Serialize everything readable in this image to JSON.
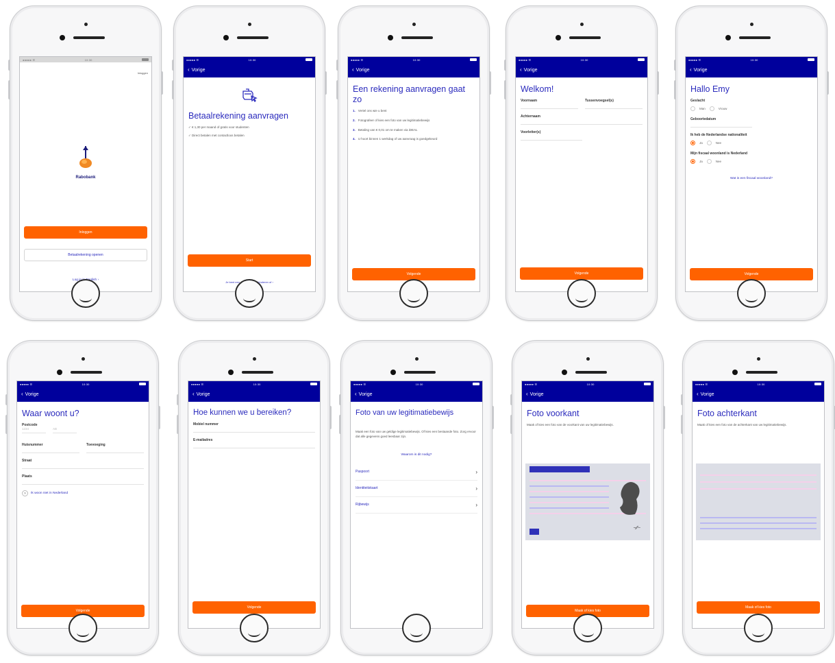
{
  "screens": {
    "s1": {
      "back_label": "",
      "top_right": "Inloggen",
      "logo_text": "Rabobank",
      "primary": "Inloggen",
      "secondary": "Betaalrekening openen",
      "link": "Log in in English  ›"
    },
    "s2": {
      "back_label": "Vorige",
      "title": "Betaalrekening aanvragen",
      "bullets": [
        "€ 1,30 per maand of gratis voor studenten",
        "Direct betalen met contactloos betalen"
      ],
      "primary": "Start",
      "link": "Je bent een rekening voor kinderen of  ›"
    },
    "s3": {
      "back_label": "Vorige",
      "title": "Een rekening aanvragen gaat zo",
      "steps": [
        "Vertel ons wie u bent",
        "Fotografeer of kies een foto van uw legitimatiebewijs",
        "Betaling van € 0,01 om te maken via iDEAL",
        "U hoort binnen 1 werkdag of uw aanvraag is goedgekeurd"
      ],
      "primary": "Volgende"
    },
    "s4": {
      "back_label": "Vorige",
      "title": "Welkom!",
      "first_name": "Voornaam",
      "infix": "Tussenvoegsel(s)",
      "last_name": "Achternaam",
      "initials": "Voorletter(s)",
      "primary": "Volgende"
    },
    "s5": {
      "back_label": "Vorige",
      "title": "Hallo Emy",
      "gender_label": "Geslacht",
      "gender_opts": [
        "Man",
        "Vrouw"
      ],
      "dob_label": "Geboortedatum",
      "nationality_label": "Ik heb de Nederlandse nationaliteit",
      "nat_opts": [
        "Ja",
        "Nee"
      ],
      "residence_label": "Mijn fiscaal woonland is Nederland",
      "res_opts": [
        "Ja",
        "Nee"
      ],
      "link": "Wat is een fiscaal woonland?",
      "primary": "Volgende"
    },
    "s6": {
      "back_label": "Vorige",
      "title": "Waar woont u?",
      "postcode_label": "Postcode",
      "postcode_ph": "1234",
      "postcode_ph2": "AB",
      "house_label": "Huisnummer",
      "addition_label": "Toevoeging",
      "street_label": "Straat",
      "city_label": "Plaats",
      "abroad": "Ik woon niet in Nederland",
      "primary": "Volgende"
    },
    "s7": {
      "back_label": "Vorige",
      "title": "Hoe kunnen we u bereiken?",
      "mobile_label": "Mobiel nummer",
      "email_label": "E-mailadres",
      "primary": "Volgende"
    },
    "s8": {
      "back_label": "Vorige",
      "title": "Foto van uw legitimatiebewijs",
      "text": "Maak een foto van uw geldige legitimatiebewijs. Of kies een bestaande foto. Zorg ervoor dat alle gegevens goed leesbaar zijn.",
      "why_link": "Waarom is dit nodig?",
      "docs": [
        "Paspoort",
        "Identiteitskaart",
        "Rijbewijs"
      ]
    },
    "s9": {
      "back_label": "Vorige",
      "title": "Foto voorkant",
      "text": "Maak of kies een foto van de voorkant van uw legitimatiebewijs.",
      "primary": "Maak of kies foto"
    },
    "s10": {
      "back_label": "Vorige",
      "title": "Foto achterkant",
      "text": "Maak of kies een foto van de achterkant van uw legitimatiebewijs.",
      "primary": "Maak of kies foto"
    }
  },
  "status": {
    "carrier": "●●●●● ☰",
    "time": "10:30",
    "battery": "100%"
  },
  "colors": {
    "brand_blue": "#00009c",
    "accent_orange": "#ff6200",
    "title_blue": "#2b2bbd"
  }
}
